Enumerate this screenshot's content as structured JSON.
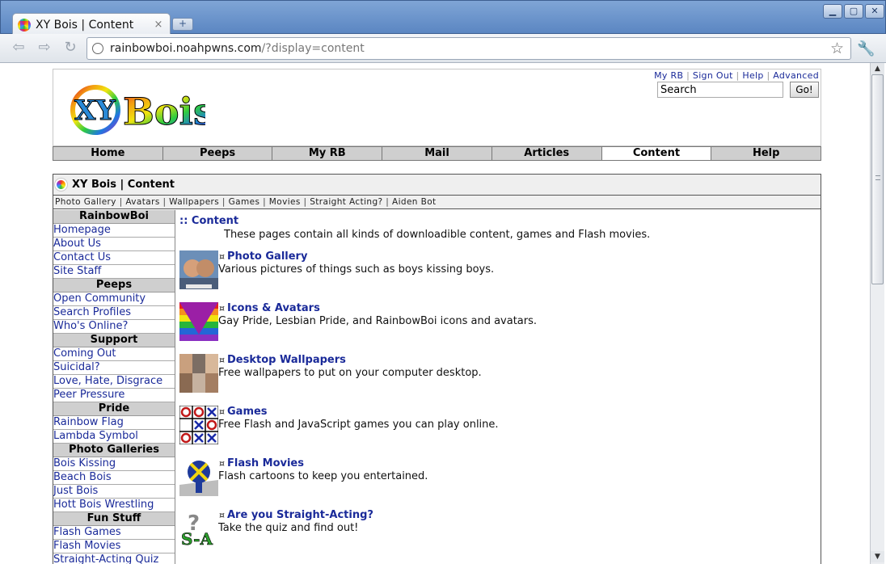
{
  "browser": {
    "tab_title": "XY Bois | Content",
    "tab_close": "×",
    "new_tab": "+",
    "url_host": "rainbowboi.noahpwns.com",
    "url_path": "/?display=content"
  },
  "header": {
    "logo_text": "XY Bois",
    "top_links": [
      "My RB",
      "Sign Out",
      "Help",
      "Advanced"
    ],
    "search_value": "Search",
    "go_label": "Go!"
  },
  "nav": {
    "tabs": [
      "Home",
      "Peeps",
      "My RB",
      "Mail",
      "Articles",
      "Content",
      "Help"
    ],
    "active": "Content"
  },
  "content": {
    "title": "XY Bois | Content",
    "subnav": [
      "Photo Gallery",
      "Avatars",
      "Wallpapers",
      "Games",
      "Movies",
      "Straight Acting?",
      "Aiden Bot"
    ]
  },
  "sidebar": {
    "sections": [
      {
        "heading": "RainbowBoi",
        "items": [
          "Homepage",
          "About Us",
          "Contact Us",
          "Site Staff"
        ]
      },
      {
        "heading": "Peeps",
        "items": [
          "Open Community",
          "Search Profiles",
          "Who's Online?"
        ]
      },
      {
        "heading": "Support",
        "items": [
          "Coming Out",
          "Suicidal?",
          "Love, Hate, Disgrace",
          "Peer Pressure"
        ]
      },
      {
        "heading": "Pride",
        "items": [
          "Rainbow Flag",
          "Lambda Symbol"
        ]
      },
      {
        "heading": "Photo Galleries",
        "items": [
          "Bois Kissing",
          "Beach Bois",
          "Just Bois",
          "Hott Bois Wrestling"
        ]
      },
      {
        "heading": "Fun Stuff",
        "items": [
          "Flash Games",
          "Flash Movies",
          "Straight-Acting Quiz"
        ]
      }
    ]
  },
  "main": {
    "section_title": ":: Content",
    "intro": "These pages contain all kinds of downloadible content, games and Flash movies.",
    "bullet": "¤",
    "entries": [
      {
        "title": "Photo Gallery",
        "desc": "Various pictures of things such as boys kissing boys.",
        "icon": "photo-gallery-thumb"
      },
      {
        "title": "Icons & Avatars",
        "desc": "Gay Pride, Lesbian Pride, and RainbowBoi icons and avatars.",
        "icon": "pride-triangle-thumb"
      },
      {
        "title": "Desktop Wallpapers",
        "desc": "Free wallpapers to put on your computer desktop.",
        "icon": "wallpapers-thumb"
      },
      {
        "title": "Games",
        "desc": "Free Flash and JavaScript games you can play online.",
        "icon": "tic-tac-toe-thumb"
      },
      {
        "title": "Flash Movies",
        "desc": "Flash cartoons to keep you entertained.",
        "icon": "flash-movies-thumb"
      },
      {
        "title": "Are you Straight-Acting?",
        "desc": "Take the quiz and find out!",
        "icon": "straight-acting-thumb"
      }
    ]
  }
}
